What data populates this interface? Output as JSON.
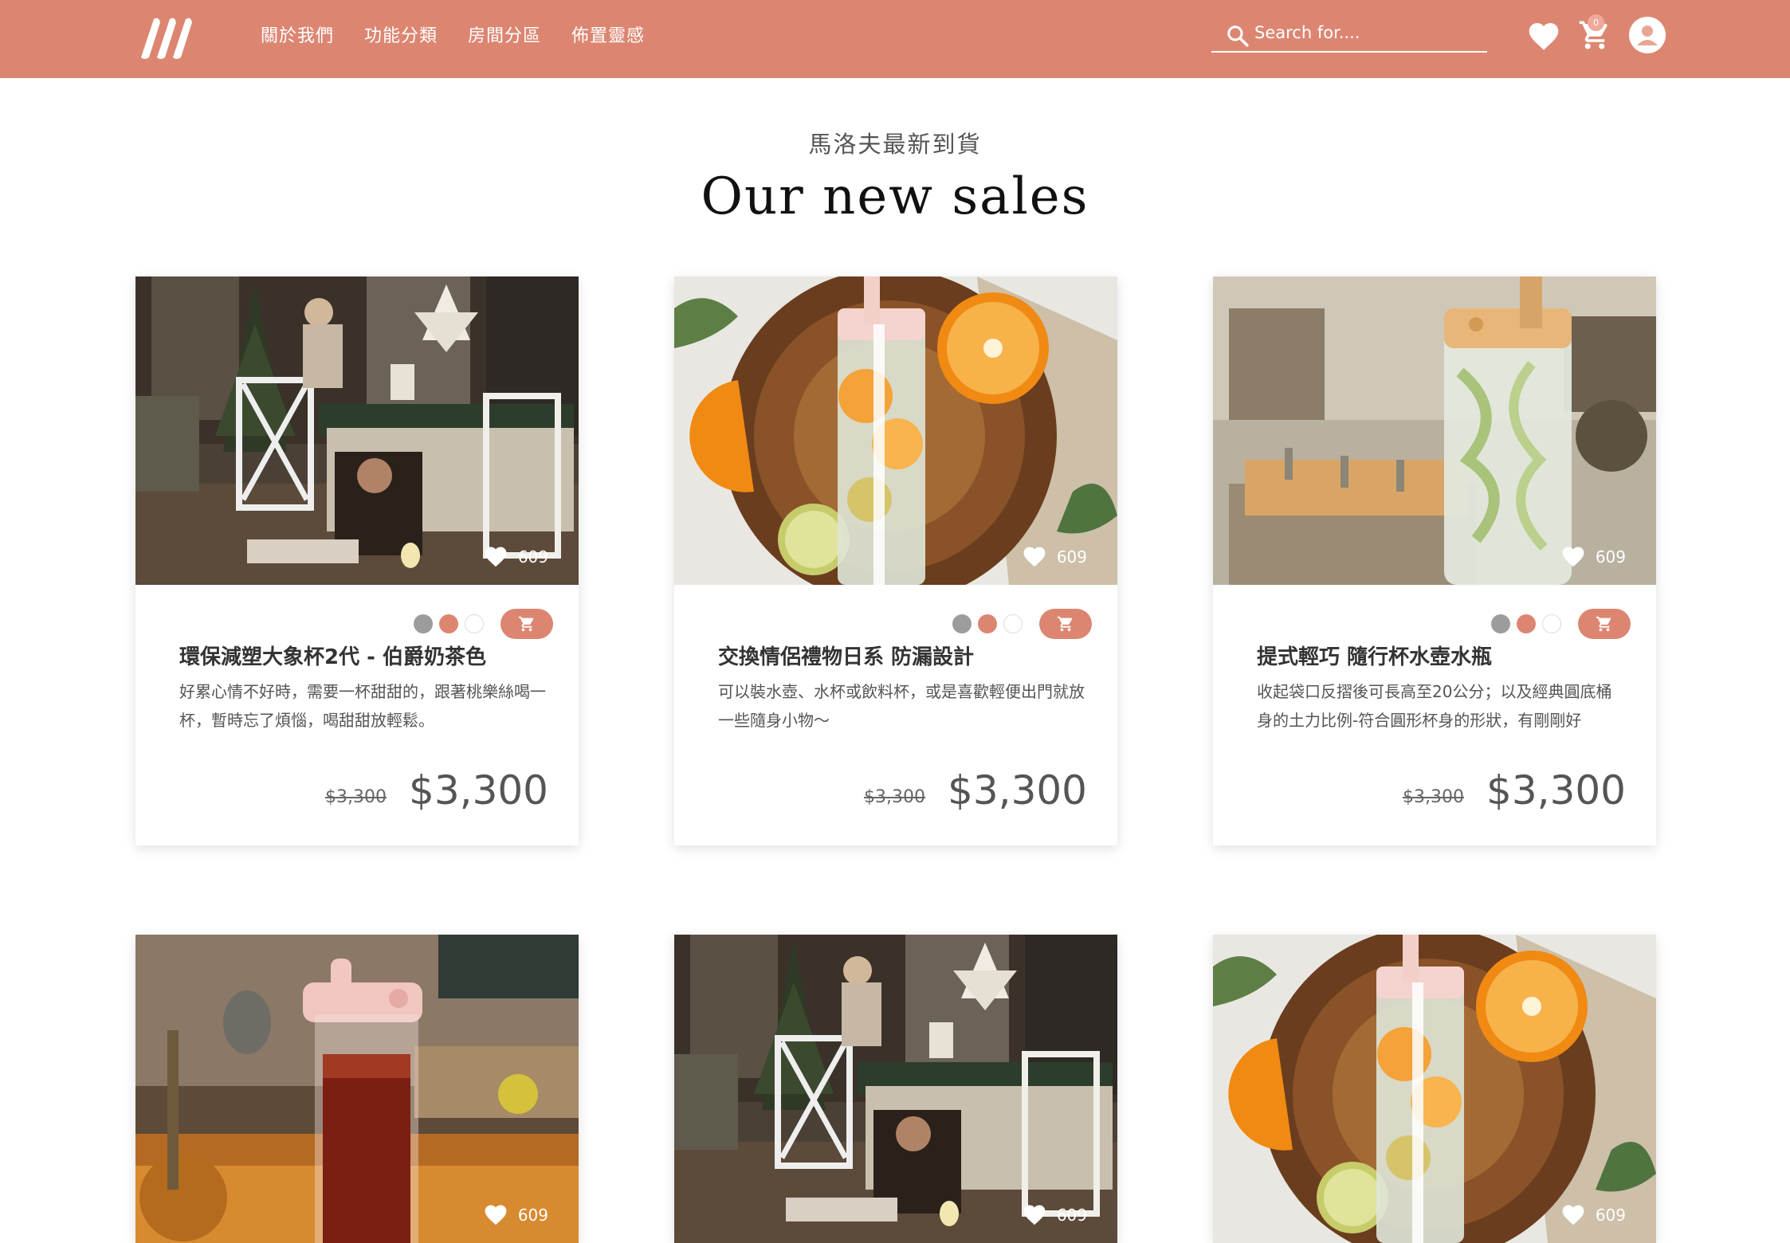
{
  "header": {
    "nav": [
      "關於我們",
      "功能分類",
      "房間分區",
      "佈置靈感"
    ],
    "search_placeholder": "Search for....",
    "cart_count": "0",
    "accent_color": "#dc8672",
    "icons": [
      "logo-icon",
      "search-icon",
      "heart-icon",
      "cart-icon",
      "user-icon"
    ]
  },
  "section": {
    "subtitle": "馬洛夫最新到貨",
    "title": "Our new sales"
  },
  "products": [
    {
      "image": "christmas-dining-room",
      "likes": "609",
      "colors": [
        "gray",
        "rose",
        "white"
      ],
      "title": "環保減塑大象杯2代 - 伯爵奶茶色",
      "desc": "好累心情不好時，需要一杯甜甜的，跟著桃樂絲喝一杯，暫時忘了煩惱，喝甜甜放輕鬆。",
      "old_price": "$3,300",
      "price": "$3,300"
    },
    {
      "image": "citrus-infuser-bottle",
      "likes": "609",
      "colors": [
        "gray",
        "rose",
        "white"
      ],
      "title": "交換情侶禮物日系 防漏設計",
      "desc": "可以裝水壺、水杯或飲料杯，或是喜歡輕便出門就放一些隨身小物～",
      "old_price": "$3,300",
      "price": "$3,300"
    },
    {
      "image": "cucumber-water-bottle",
      "likes": "609",
      "colors": [
        "gray",
        "rose",
        "white"
      ],
      "title": "提式輕巧 隨行杯水壺水瓶",
      "desc": "收起袋口反摺後可長高至20公分；以及經典圓底桶身的土力比例-符合圓形杯身的形狀，有剛剛好",
      "old_price": "$3,300",
      "price": "$3,300"
    },
    {
      "image": "tea-tumbler",
      "likes": "609"
    },
    {
      "image": "christmas-dining-room",
      "likes": "609"
    },
    {
      "image": "citrus-infuser-bottle",
      "likes": "609"
    }
  ]
}
